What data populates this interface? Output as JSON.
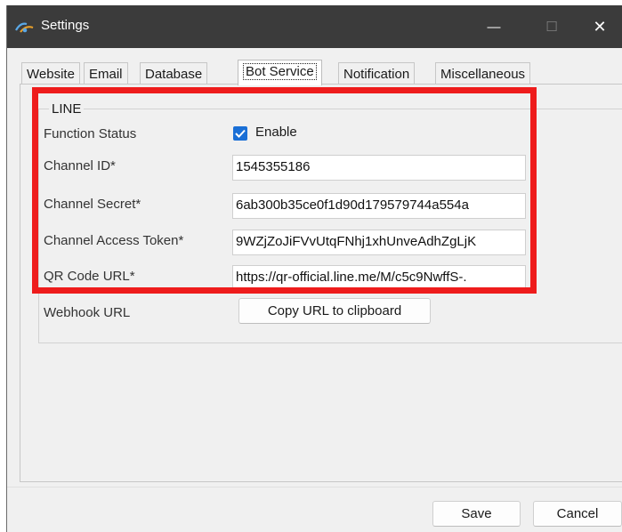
{
  "window": {
    "title": "Settings",
    "controls": {
      "minimize": "—",
      "maximize": "☐",
      "close": "✕"
    }
  },
  "tabs": [
    {
      "label": "Website",
      "active": false
    },
    {
      "label": "Email",
      "active": false
    },
    {
      "label": "Database",
      "active": false
    },
    {
      "label": "Bot Service",
      "active": true
    },
    {
      "label": "Notification",
      "active": false
    },
    {
      "label": "Miscellaneous",
      "active": false
    }
  ],
  "line_group": {
    "title": "LINE",
    "function_status": {
      "label": "Function Status",
      "checkbox_label": "Enable",
      "checked": true
    },
    "channel_id": {
      "label": "Channel ID*",
      "value": "1545355186"
    },
    "channel_secret": {
      "label": "Channel Secret*",
      "value": "6ab300b35ce0f1d90d179579744a554a"
    },
    "access_token": {
      "label": "Channel Access Token*",
      "value": "9WZjZoJiFVvUtqFNhj1xhUnveAdhZgLjK"
    },
    "qr_code_url": {
      "label": "QR Code URL*",
      "value": "https://qr-official.line.me/M/c5c9NwffS-."
    },
    "webhook_url": {
      "label": "Webhook URL",
      "button_label": "Copy URL to clipboard"
    }
  },
  "footer": {
    "save_label": "Save",
    "cancel_label": "Cancel"
  },
  "colors": {
    "titlebar": "#3b3b3b",
    "highlight": "#ee1c1c",
    "checkbox": "#1a6fd6"
  }
}
